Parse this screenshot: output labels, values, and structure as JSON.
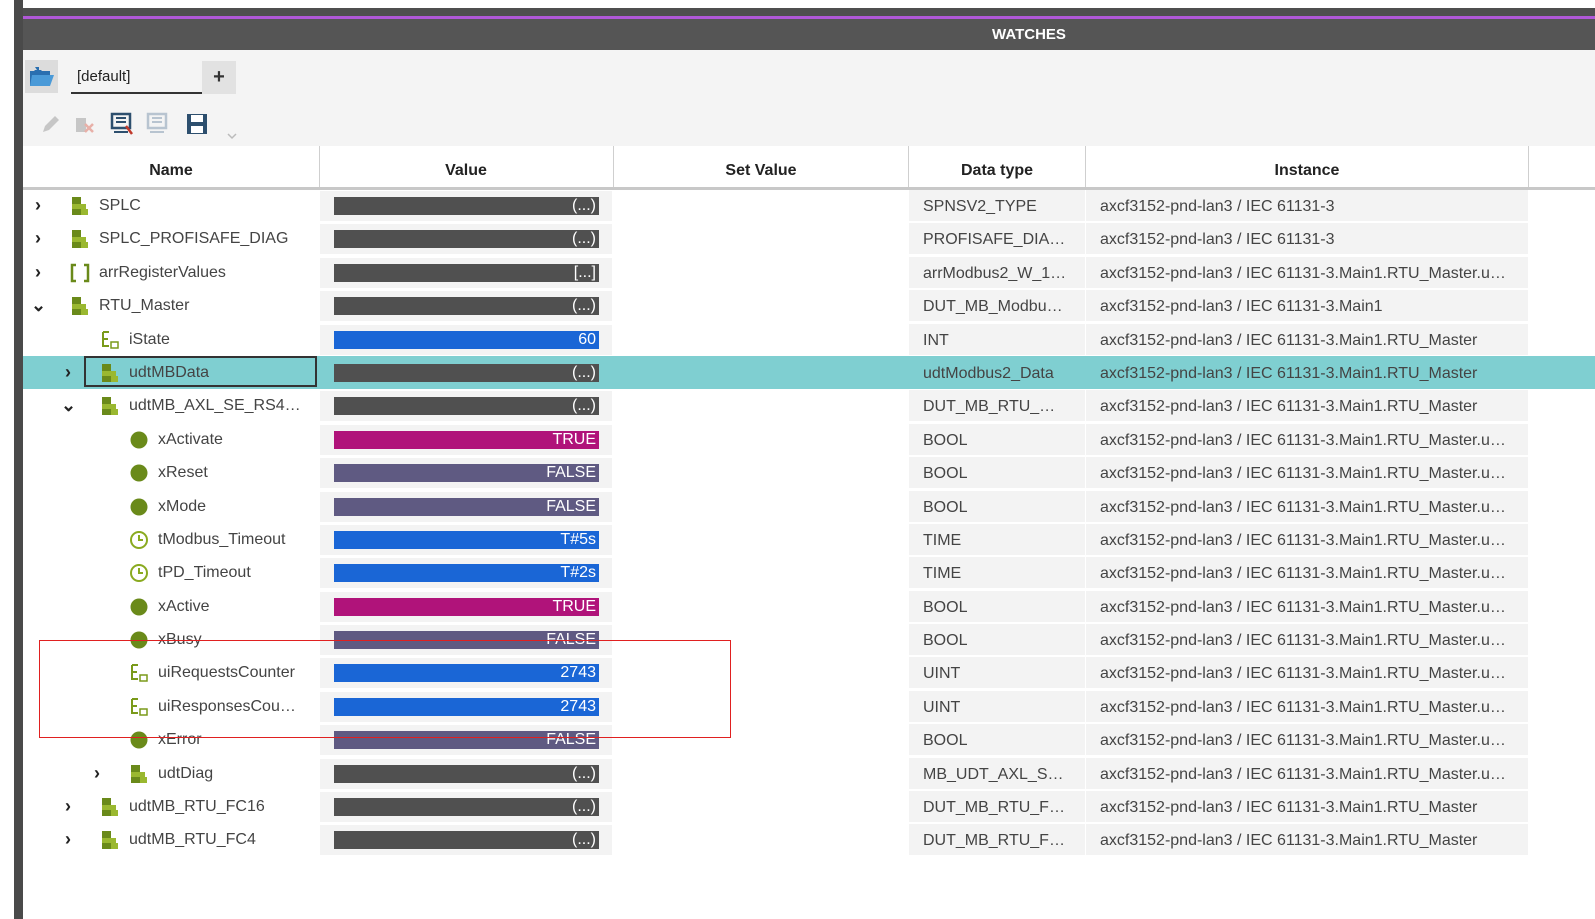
{
  "header": {
    "title": "WATCHES"
  },
  "tabs": {
    "active": "[default]",
    "add_label": "+"
  },
  "toolbar": {
    "icons": [
      "edit-icon",
      "delete-icon",
      "add-watch-icon",
      "remove-watch-icon",
      "save-icon",
      "more-icon"
    ]
  },
  "columns": [
    "Name",
    "Value",
    "Set Value",
    "Data type",
    "Instance"
  ],
  "colors": {
    "struct": "#505050",
    "int": "#1a66d6",
    "bool_true": "#b0137a",
    "bool_false": "#5f5a82",
    "selection": "#7fcfd1",
    "highlight": "#e02020",
    "accent": "#b058d8"
  },
  "rows": [
    {
      "name": "SPLC",
      "icon": "struct-icon",
      "level": 0,
      "expander": "›",
      "value": "(...)",
      "vtype": "struct",
      "dtype": "SPNSV2_TYPE",
      "instance": "axcf3152-pnd-lan3 / IEC 61131-3"
    },
    {
      "name": "SPLC_PROFISAFE_DIAG",
      "icon": "struct-icon",
      "level": 0,
      "expander": "›",
      "value": "(...)",
      "vtype": "struct",
      "dtype": "PROFISAFE_DIA…",
      "instance": "axcf3152-pnd-lan3 / IEC 61131-3"
    },
    {
      "name": "arrRegisterValues",
      "icon": "array-icon",
      "level": 0,
      "expander": "›",
      "value": "[...]",
      "vtype": "struct",
      "dtype": "arrModbus2_W_1…",
      "instance": "axcf3152-pnd-lan3 / IEC 61131-3.Main1.RTU_Master.u…"
    },
    {
      "name": "RTU_Master",
      "icon": "struct-icon",
      "level": 0,
      "expander": "⌄",
      "value": "(...)",
      "vtype": "struct",
      "dtype": "DUT_MB_Modbu…",
      "instance": "axcf3152-pnd-lan3 / IEC 61131-3.Main1"
    },
    {
      "name": "iState",
      "icon": "int-icon",
      "level": 1,
      "expander": "",
      "value": "60",
      "vtype": "int",
      "dtype": "INT",
      "instance": "axcf3152-pnd-lan3 / IEC 61131-3.Main1.RTU_Master"
    },
    {
      "name": "udtMBData",
      "icon": "struct-icon",
      "level": 1,
      "expander": "›",
      "value": "(...)",
      "vtype": "struct",
      "dtype": "udtModbus2_Data",
      "instance": "axcf3152-pnd-lan3 / IEC 61131-3.Main1.RTU_Master",
      "selected": true
    },
    {
      "name": "udtMB_AXL_SE_RS4…",
      "icon": "struct-icon",
      "level": 1,
      "expander": "⌄",
      "value": "(...)",
      "vtype": "struct",
      "dtype": "DUT_MB_RTU_…",
      "instance": "axcf3152-pnd-lan3 / IEC 61131-3.Main1.RTU_Master"
    },
    {
      "name": "xActivate",
      "icon": "bool-icon",
      "level": 2,
      "expander": "",
      "value": "TRUE",
      "vtype": "bool_true",
      "dtype": "BOOL",
      "instance": "axcf3152-pnd-lan3 / IEC 61131-3.Main1.RTU_Master.u…"
    },
    {
      "name": "xReset",
      "icon": "bool-icon",
      "level": 2,
      "expander": "",
      "value": "FALSE",
      "vtype": "bool_false",
      "dtype": "BOOL",
      "instance": "axcf3152-pnd-lan3 / IEC 61131-3.Main1.RTU_Master.u…"
    },
    {
      "name": "xMode",
      "icon": "bool-icon",
      "level": 2,
      "expander": "",
      "value": "FALSE",
      "vtype": "bool_false",
      "dtype": "BOOL",
      "instance": "axcf3152-pnd-lan3 / IEC 61131-3.Main1.RTU_Master.u…"
    },
    {
      "name": "tModbus_Timeout",
      "icon": "time-icon",
      "level": 2,
      "expander": "",
      "value": "T#5s",
      "vtype": "int",
      "dtype": "TIME",
      "instance": "axcf3152-pnd-lan3 / IEC 61131-3.Main1.RTU_Master.u…"
    },
    {
      "name": "tPD_Timeout",
      "icon": "time-icon",
      "level": 2,
      "expander": "",
      "value": "T#2s",
      "vtype": "int",
      "dtype": "TIME",
      "instance": "axcf3152-pnd-lan3 / IEC 61131-3.Main1.RTU_Master.u…"
    },
    {
      "name": "xActive",
      "icon": "bool-icon",
      "level": 2,
      "expander": "",
      "value": "TRUE",
      "vtype": "bool_true",
      "dtype": "BOOL",
      "instance": "axcf3152-pnd-lan3 / IEC 61131-3.Main1.RTU_Master.u…"
    },
    {
      "name": "xBusy",
      "icon": "bool-icon",
      "level": 2,
      "expander": "",
      "value": "FALSE",
      "vtype": "bool_false",
      "dtype": "BOOL",
      "instance": "axcf3152-pnd-lan3 / IEC 61131-3.Main1.RTU_Master.u…"
    },
    {
      "name": "uiRequestsCounter",
      "icon": "int-icon",
      "level": 2,
      "expander": "",
      "value": "2743",
      "vtype": "int",
      "dtype": "UINT",
      "instance": "axcf3152-pnd-lan3 / IEC 61131-3.Main1.RTU_Master.u…"
    },
    {
      "name": "uiResponsesCou…",
      "icon": "int-icon",
      "level": 2,
      "expander": "",
      "value": "2743",
      "vtype": "int",
      "dtype": "UINT",
      "instance": "axcf3152-pnd-lan3 / IEC 61131-3.Main1.RTU_Master.u…"
    },
    {
      "name": "xError",
      "icon": "bool-icon",
      "level": 2,
      "expander": "",
      "value": "FALSE",
      "vtype": "bool_false",
      "dtype": "BOOL",
      "instance": "axcf3152-pnd-lan3 / IEC 61131-3.Main1.RTU_Master.u…"
    },
    {
      "name": "udtDiag",
      "icon": "struct-icon",
      "level": 2,
      "expander": "›",
      "value": "(...)",
      "vtype": "struct",
      "dtype": "MB_UDT_AXL_S…",
      "instance": "axcf3152-pnd-lan3 / IEC 61131-3.Main1.RTU_Master.u…"
    },
    {
      "name": "udtMB_RTU_FC16",
      "icon": "struct-icon",
      "level": 1,
      "expander": "›",
      "value": "(...)",
      "vtype": "struct",
      "dtype": "DUT_MB_RTU_F…",
      "instance": "axcf3152-pnd-lan3 / IEC 61131-3.Main1.RTU_Master"
    },
    {
      "name": "udtMB_RTU_FC4",
      "icon": "struct-icon",
      "level": 1,
      "expander": "›",
      "value": "(...)",
      "vtype": "struct",
      "dtype": "DUT_MB_RTU_F…",
      "instance": "axcf3152-pnd-lan3 / IEC 61131-3.Main1.RTU_Master"
    }
  ]
}
